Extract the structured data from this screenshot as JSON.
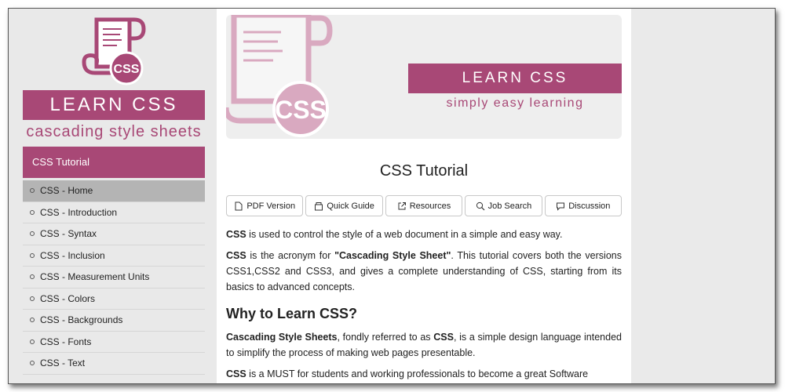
{
  "sidebar": {
    "logo_text": "CSS",
    "banner_title": "LEARN CSS",
    "banner_subtitle": "cascading style sheets",
    "section_heading": "CSS Tutorial",
    "items": [
      {
        "label": "CSS - Home",
        "active": true
      },
      {
        "label": "CSS - Introduction",
        "active": false
      },
      {
        "label": "CSS - Syntax",
        "active": false
      },
      {
        "label": "CSS - Inclusion",
        "active": false
      },
      {
        "label": "CSS - Measurement Units",
        "active": false
      },
      {
        "label": "CSS - Colors",
        "active": false
      },
      {
        "label": "CSS - Backgrounds",
        "active": false
      },
      {
        "label": "CSS - Fonts",
        "active": false
      },
      {
        "label": "CSS - Text",
        "active": false
      }
    ]
  },
  "hero": {
    "logo_text": "CSS",
    "title": "LEARN CSS",
    "subtitle": "simply easy learning"
  },
  "page": {
    "title": "CSS Tutorial"
  },
  "buttons": {
    "pdf": "PDF Version",
    "quick": "Quick Guide",
    "resources": "Resources",
    "jobs": "Job Search",
    "discussion": "Discussion"
  },
  "content": {
    "p1_bold": "CSS",
    "p1_rest": " is used to control the style of a web document in a simple and easy way.",
    "p2_bold": "CSS",
    "p2_mid": " is the acronym for ",
    "p2_quote": "\"Cascading Style Sheet\"",
    "p2_rest": ". This tutorial covers both the versions CSS1,CSS2 and CSS3, and gives a complete understanding of CSS, starting from its basics to advanced concepts.",
    "h2": "Why to Learn CSS?",
    "p3_bold1": "Cascading Style Sheets",
    "p3_mid": ", fondly referred to as ",
    "p3_bold2": "CSS",
    "p3_rest": ", is a simple design language intended to simplify the process of making web pages presentable.",
    "p4_bold": "CSS",
    "p4_rest": " is a MUST for students and working professionals to become a great Software"
  },
  "colors": {
    "brand": "#a84876",
    "brand_light": "#d9a9c0",
    "active_item": "#b4b4b4"
  }
}
